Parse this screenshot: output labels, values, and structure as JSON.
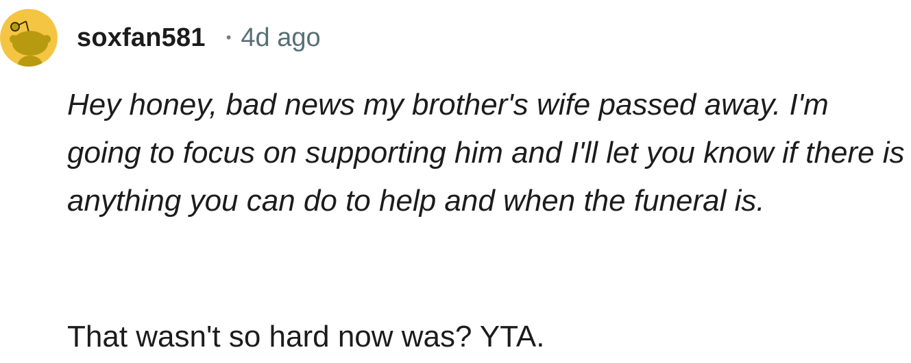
{
  "comment": {
    "author": "soxfan581",
    "separator": "•",
    "timestamp": "4d ago",
    "avatar_icon": "snoo-avatar-icon",
    "avatar_color": "#f4c542",
    "quote": "Hey honey, bad news my brother's wife passed away. I'm going to focus on supporting him and I'll let you know if there is anything you can do to help and when the funeral is.",
    "reply": "That wasn't so hard now was? YTA."
  }
}
